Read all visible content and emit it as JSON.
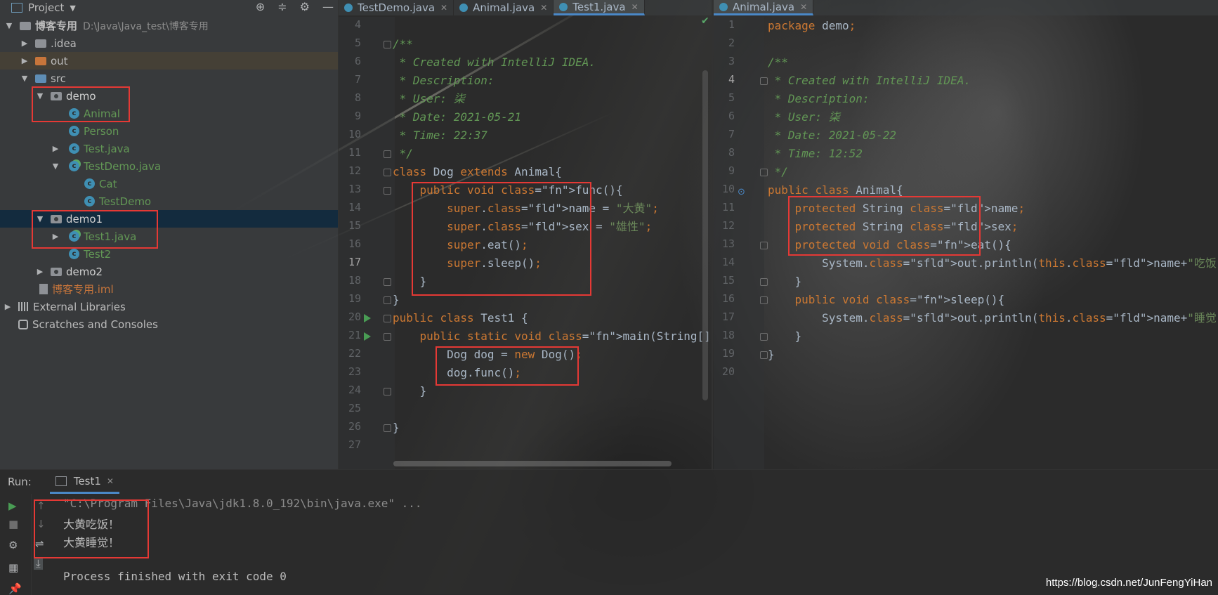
{
  "project_panel": {
    "title": "Project",
    "tree": [
      {
        "label": "博客专用",
        "path": "D:\\Java\\Java_test\\博客专用"
      },
      {
        "label": ".idea"
      },
      {
        "label": "out"
      },
      {
        "label": "src"
      },
      {
        "label": "demo"
      },
      {
        "label": "Animal"
      },
      {
        "label": "Person"
      },
      {
        "label": "Test.java"
      },
      {
        "label": "TestDemo.java"
      },
      {
        "label": "Cat"
      },
      {
        "label": "TestDemo"
      },
      {
        "label": "demo1"
      },
      {
        "label": "Test1.java"
      },
      {
        "label": "Test2"
      },
      {
        "label": "demo2"
      },
      {
        "label": "博客专用.iml"
      },
      {
        "label": "External Libraries"
      },
      {
        "label": "Scratches and Consoles"
      }
    ]
  },
  "tabs_left": [
    {
      "name": "TestDemo.java"
    },
    {
      "name": "Animal.java"
    },
    {
      "name": "Test1.java"
    }
  ],
  "tabs_right": [
    {
      "name": "Animal.java"
    }
  ],
  "editor_left": {
    "line_numbers": [
      "4",
      "5",
      "6",
      "7",
      "8",
      "9",
      "10",
      "11",
      "12",
      "13",
      "14",
      "15",
      "16",
      "17",
      "18",
      "19",
      "20",
      "21",
      "22",
      "23",
      "24",
      "25",
      "26",
      "27"
    ],
    "code": [
      "",
      "/**",
      " * Created with IntelliJ IDEA.",
      " * Description:",
      " * User: 柒",
      " * Date: 2021-05-21",
      " * Time: 22:37",
      " */",
      "class Dog extends Animal{",
      "    public void func(){",
      "        super.name = \"大黄\";",
      "        super.sex = \"雄性\";",
      "        super.eat();",
      "        super.sleep();",
      "    }",
      "}",
      "public class Test1 {",
      "    public static void main(String[] args) {",
      "        Dog dog = new Dog();",
      "        dog.func();",
      "    }",
      "",
      "}",
      ""
    ]
  },
  "editor_right": {
    "line_numbers": [
      "1",
      "2",
      "3",
      "4",
      "5",
      "6",
      "7",
      "8",
      "9",
      "10",
      "11",
      "12",
      "13",
      "14",
      "15",
      "16",
      "17",
      "18",
      "19",
      "20"
    ],
    "code": [
      "package demo;",
      "",
      "/**",
      " * Created with IntelliJ IDEA.",
      " * Description:",
      " * User: 柒",
      " * Date: 2021-05-22",
      " * Time: 12:52",
      " */",
      "public class Animal{",
      "    protected String name;",
      "    protected String sex;",
      "    protected void eat(){",
      "        System.out.println(this.name+\"吃饭！\");",
      "    }",
      "    public void sleep(){",
      "        System.out.println(this.name+\"睡觉！\");",
      "    }",
      "}",
      ""
    ]
  },
  "run_panel": {
    "label": "Run:",
    "tab_name": "Test1",
    "output": [
      "\"C:\\Program Files\\Java\\jdk1.8.0_192\\bin\\java.exe\" ...",
      "大黄吃饭！",
      "大黄睡觉！",
      "",
      "Process finished with exit code 0"
    ]
  },
  "watermark": "https://blog.csdn.net/JunFengYiHan",
  "colors": {
    "keyword": "#cc7832",
    "function": "#ffc66d",
    "string": "#6a8759",
    "comment": "#629755",
    "field": "#9876aa",
    "highlight_box": "#e53935"
  }
}
